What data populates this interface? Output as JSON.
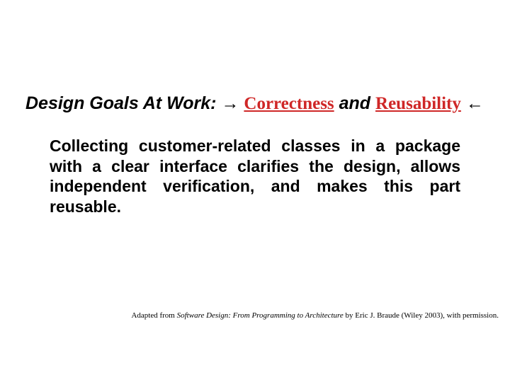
{
  "title": {
    "prefix": "Design Goals At Work:",
    "arrow_right": "→",
    "goal1": "Correctness",
    "connector": "and",
    "goal2": "Reusability",
    "arrow_left": "←"
  },
  "body": "Collecting customer-related classes in a package with a clear interface clarifies the design, allows independent verification, and makes this part reusable.",
  "attribution": {
    "before": "Adapted from ",
    "book": "Software Design: From Programming to Architecture",
    "after": " by Eric J. Braude (Wiley 2003), with permission."
  }
}
